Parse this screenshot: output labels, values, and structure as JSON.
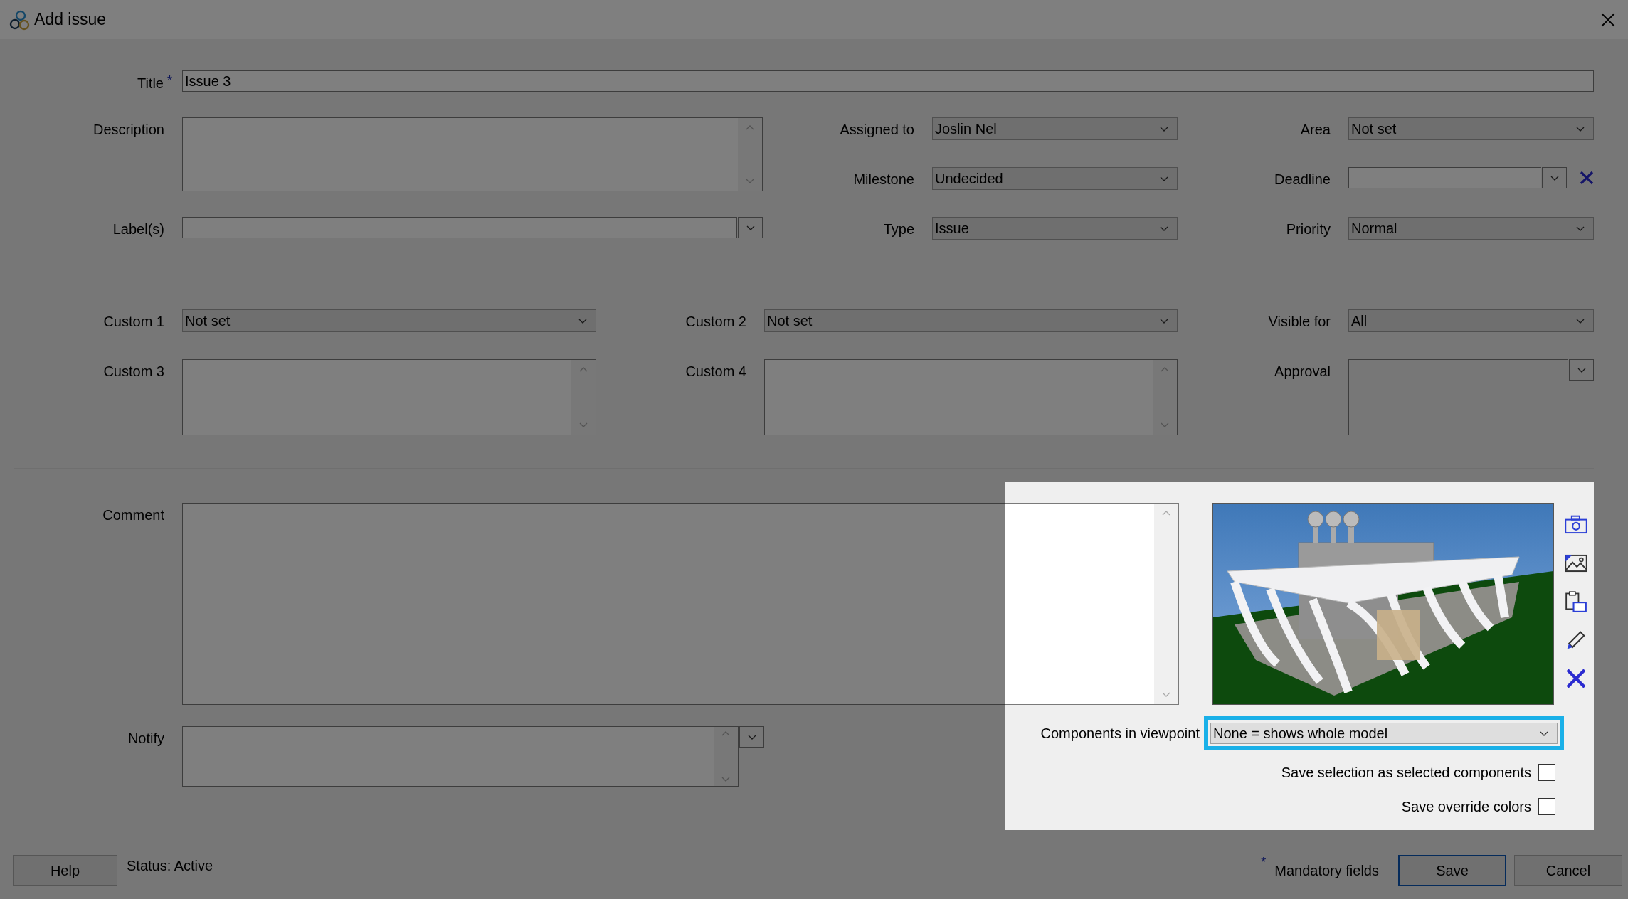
{
  "window": {
    "title": "Add issue"
  },
  "title_field": {
    "label": "Title",
    "required_mark": "*",
    "value": "Issue 3"
  },
  "top_fields": [
    {
      "label": "Description",
      "kind": "textarea"
    },
    {
      "label": "Assigned to",
      "kind": "dropdown",
      "value": "Joslin Nel"
    },
    {
      "label": "Area",
      "kind": "dropdown",
      "value": "Not set"
    },
    {
      "label": "Milestone",
      "kind": "dropdown",
      "value": "Undecided"
    },
    {
      "label": "Deadline",
      "kind": "date"
    },
    {
      "label": "Label(s)",
      "kind": "combo"
    },
    {
      "label": "Type",
      "kind": "dropdown",
      "value": "Issue"
    },
    {
      "label": "Priority",
      "kind": "dropdown",
      "value": "Normal"
    }
  ],
  "custom_fields": [
    {
      "label": "Custom 1",
      "kind": "dropdown",
      "value": "Not set"
    },
    {
      "label": "Custom 2",
      "kind": "dropdown",
      "value": "Not set"
    },
    {
      "label": "Visible for",
      "kind": "dropdown",
      "value": "All"
    },
    {
      "label": "Custom 3",
      "kind": "textarea"
    },
    {
      "label": "Custom 4",
      "kind": "textarea"
    },
    {
      "label": "Approval",
      "kind": "list"
    }
  ],
  "comment": {
    "label": "Comment"
  },
  "notify": {
    "label": "Notify"
  },
  "viewpoint": {
    "components_label": "Components in viewpoint",
    "components_value": "None = shows whole model",
    "options": [
      {
        "label": "Save selection as selected components",
        "checked": false
      },
      {
        "label": "Save override colors",
        "checked": false
      }
    ]
  },
  "footer": {
    "help": "Help",
    "status": "Status: Active",
    "mandatory_mark": "*",
    "mandatory_text": "Mandatory fields",
    "buttons": [
      {
        "label": "Save",
        "default": true
      },
      {
        "label": "Cancel",
        "default": false
      }
    ]
  }
}
